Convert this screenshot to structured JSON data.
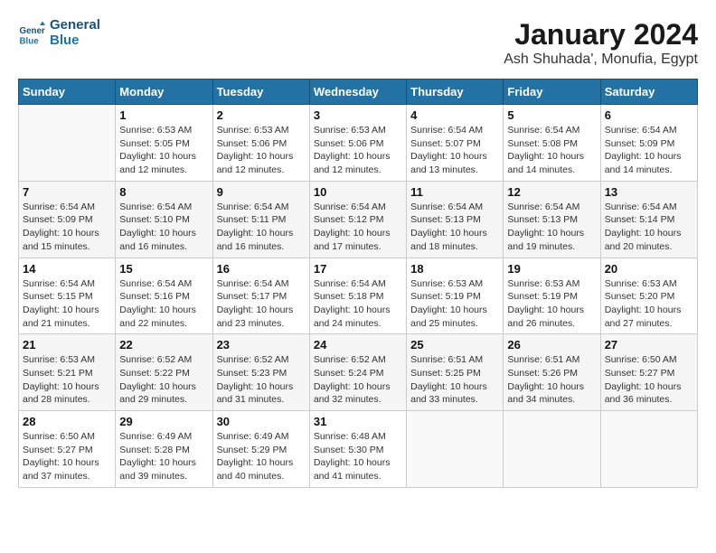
{
  "logo": {
    "line1": "General",
    "line2": "Blue"
  },
  "title": "January 2024",
  "subtitle": "Ash Shuhada', Monufia, Egypt",
  "headers": [
    "Sunday",
    "Monday",
    "Tuesday",
    "Wednesday",
    "Thursday",
    "Friday",
    "Saturday"
  ],
  "weeks": [
    [
      {
        "day": "",
        "sunrise": "",
        "sunset": "",
        "daylight": ""
      },
      {
        "day": "1",
        "sunrise": "Sunrise: 6:53 AM",
        "sunset": "Sunset: 5:05 PM",
        "daylight": "Daylight: 10 hours and 12 minutes."
      },
      {
        "day": "2",
        "sunrise": "Sunrise: 6:53 AM",
        "sunset": "Sunset: 5:06 PM",
        "daylight": "Daylight: 10 hours and 12 minutes."
      },
      {
        "day": "3",
        "sunrise": "Sunrise: 6:53 AM",
        "sunset": "Sunset: 5:06 PM",
        "daylight": "Daylight: 10 hours and 12 minutes."
      },
      {
        "day": "4",
        "sunrise": "Sunrise: 6:54 AM",
        "sunset": "Sunset: 5:07 PM",
        "daylight": "Daylight: 10 hours and 13 minutes."
      },
      {
        "day": "5",
        "sunrise": "Sunrise: 6:54 AM",
        "sunset": "Sunset: 5:08 PM",
        "daylight": "Daylight: 10 hours and 14 minutes."
      },
      {
        "day": "6",
        "sunrise": "Sunrise: 6:54 AM",
        "sunset": "Sunset: 5:09 PM",
        "daylight": "Daylight: 10 hours and 14 minutes."
      }
    ],
    [
      {
        "day": "7",
        "sunrise": "Sunrise: 6:54 AM",
        "sunset": "Sunset: 5:09 PM",
        "daylight": "Daylight: 10 hours and 15 minutes."
      },
      {
        "day": "8",
        "sunrise": "Sunrise: 6:54 AM",
        "sunset": "Sunset: 5:10 PM",
        "daylight": "Daylight: 10 hours and 16 minutes."
      },
      {
        "day": "9",
        "sunrise": "Sunrise: 6:54 AM",
        "sunset": "Sunset: 5:11 PM",
        "daylight": "Daylight: 10 hours and 16 minutes."
      },
      {
        "day": "10",
        "sunrise": "Sunrise: 6:54 AM",
        "sunset": "Sunset: 5:12 PM",
        "daylight": "Daylight: 10 hours and 17 minutes."
      },
      {
        "day": "11",
        "sunrise": "Sunrise: 6:54 AM",
        "sunset": "Sunset: 5:13 PM",
        "daylight": "Daylight: 10 hours and 18 minutes."
      },
      {
        "day": "12",
        "sunrise": "Sunrise: 6:54 AM",
        "sunset": "Sunset: 5:13 PM",
        "daylight": "Daylight: 10 hours and 19 minutes."
      },
      {
        "day": "13",
        "sunrise": "Sunrise: 6:54 AM",
        "sunset": "Sunset: 5:14 PM",
        "daylight": "Daylight: 10 hours and 20 minutes."
      }
    ],
    [
      {
        "day": "14",
        "sunrise": "Sunrise: 6:54 AM",
        "sunset": "Sunset: 5:15 PM",
        "daylight": "Daylight: 10 hours and 21 minutes."
      },
      {
        "day": "15",
        "sunrise": "Sunrise: 6:54 AM",
        "sunset": "Sunset: 5:16 PM",
        "daylight": "Daylight: 10 hours and 22 minutes."
      },
      {
        "day": "16",
        "sunrise": "Sunrise: 6:54 AM",
        "sunset": "Sunset: 5:17 PM",
        "daylight": "Daylight: 10 hours and 23 minutes."
      },
      {
        "day": "17",
        "sunrise": "Sunrise: 6:54 AM",
        "sunset": "Sunset: 5:18 PM",
        "daylight": "Daylight: 10 hours and 24 minutes."
      },
      {
        "day": "18",
        "sunrise": "Sunrise: 6:53 AM",
        "sunset": "Sunset: 5:19 PM",
        "daylight": "Daylight: 10 hours and 25 minutes."
      },
      {
        "day": "19",
        "sunrise": "Sunrise: 6:53 AM",
        "sunset": "Sunset: 5:19 PM",
        "daylight": "Daylight: 10 hours and 26 minutes."
      },
      {
        "day": "20",
        "sunrise": "Sunrise: 6:53 AM",
        "sunset": "Sunset: 5:20 PM",
        "daylight": "Daylight: 10 hours and 27 minutes."
      }
    ],
    [
      {
        "day": "21",
        "sunrise": "Sunrise: 6:53 AM",
        "sunset": "Sunset: 5:21 PM",
        "daylight": "Daylight: 10 hours and 28 minutes."
      },
      {
        "day": "22",
        "sunrise": "Sunrise: 6:52 AM",
        "sunset": "Sunset: 5:22 PM",
        "daylight": "Daylight: 10 hours and 29 minutes."
      },
      {
        "day": "23",
        "sunrise": "Sunrise: 6:52 AM",
        "sunset": "Sunset: 5:23 PM",
        "daylight": "Daylight: 10 hours and 31 minutes."
      },
      {
        "day": "24",
        "sunrise": "Sunrise: 6:52 AM",
        "sunset": "Sunset: 5:24 PM",
        "daylight": "Daylight: 10 hours and 32 minutes."
      },
      {
        "day": "25",
        "sunrise": "Sunrise: 6:51 AM",
        "sunset": "Sunset: 5:25 PM",
        "daylight": "Daylight: 10 hours and 33 minutes."
      },
      {
        "day": "26",
        "sunrise": "Sunrise: 6:51 AM",
        "sunset": "Sunset: 5:26 PM",
        "daylight": "Daylight: 10 hours and 34 minutes."
      },
      {
        "day": "27",
        "sunrise": "Sunrise: 6:50 AM",
        "sunset": "Sunset: 5:27 PM",
        "daylight": "Daylight: 10 hours and 36 minutes."
      }
    ],
    [
      {
        "day": "28",
        "sunrise": "Sunrise: 6:50 AM",
        "sunset": "Sunset: 5:27 PM",
        "daylight": "Daylight: 10 hours and 37 minutes."
      },
      {
        "day": "29",
        "sunrise": "Sunrise: 6:49 AM",
        "sunset": "Sunset: 5:28 PM",
        "daylight": "Daylight: 10 hours and 39 minutes."
      },
      {
        "day": "30",
        "sunrise": "Sunrise: 6:49 AM",
        "sunset": "Sunset: 5:29 PM",
        "daylight": "Daylight: 10 hours and 40 minutes."
      },
      {
        "day": "31",
        "sunrise": "Sunrise: 6:48 AM",
        "sunset": "Sunset: 5:30 PM",
        "daylight": "Daylight: 10 hours and 41 minutes."
      },
      {
        "day": "",
        "sunrise": "",
        "sunset": "",
        "daylight": ""
      },
      {
        "day": "",
        "sunrise": "",
        "sunset": "",
        "daylight": ""
      },
      {
        "day": "",
        "sunrise": "",
        "sunset": "",
        "daylight": ""
      }
    ]
  ]
}
